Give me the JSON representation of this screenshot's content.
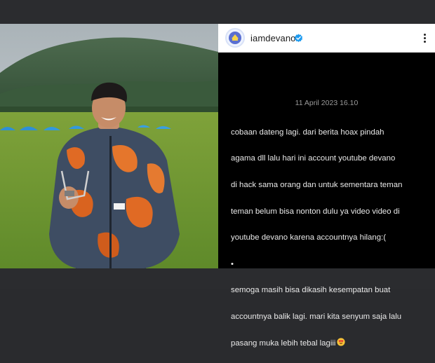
{
  "profile": {
    "username": "iamdevano",
    "avatar_icon": "avatar-logo-icon",
    "verified_icon": "verified-badge-icon",
    "more_icon": "more-options-icon"
  },
  "post": {
    "timestamp": "11 April 2023 16.10",
    "caption_lines": [
      "cobaan dateng lagi. dari berita hoax pindah",
      "agama dll lalu hari ini account youtube devano",
      "di hack sama orang dan untuk sementara teman",
      "teman belum bisa nonton dulu ya video video di",
      "youtube devano karena accountnya hilang:(",
      "•",
      "semoga masih bisa dikasih kesempatan buat",
      "accountnya balik lagi. mari kita senyum saja lalu",
      "pasang muka lebih tebal lagiii"
    ],
    "emoji": "heart-eyes-emoji"
  },
  "colors": {
    "frame": "#2b2c2f",
    "header_bg": "#ffffff",
    "post_bg": "#000000",
    "verified_blue": "#1d9bf0"
  }
}
